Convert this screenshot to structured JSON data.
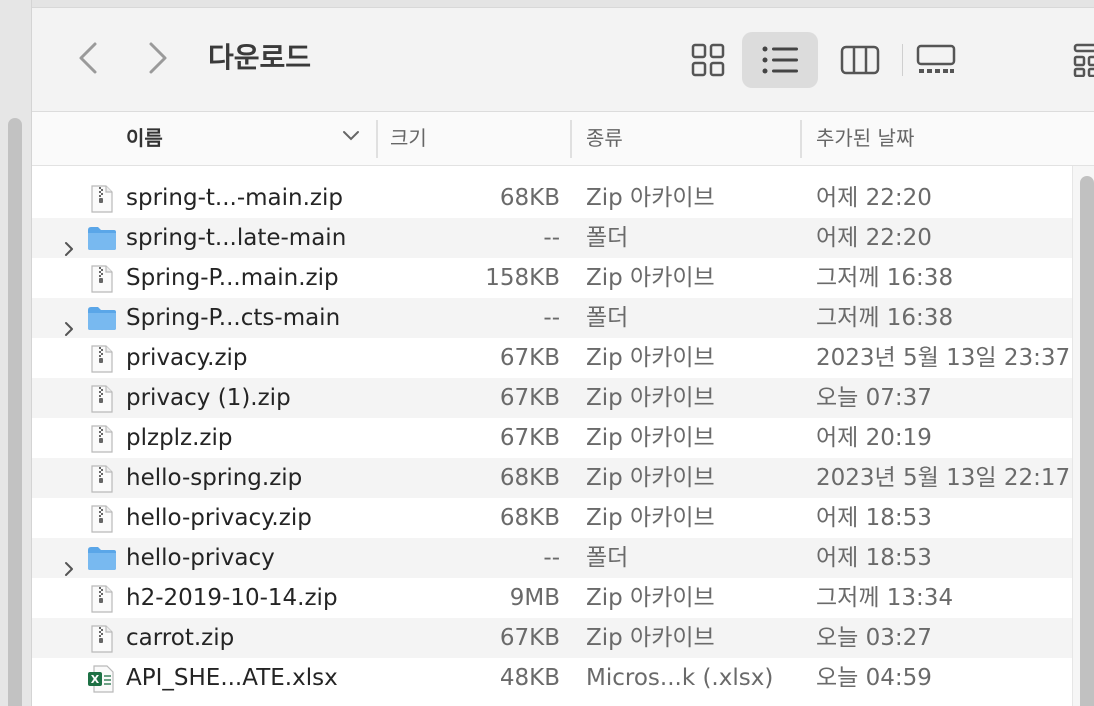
{
  "window": {
    "title": "다운로드"
  },
  "toolbar": {
    "back_icon": "chevron-left-icon",
    "forward_icon": "chevron-right-icon",
    "views": [
      {
        "name": "icon-view",
        "icon": "grid-icon",
        "active": false
      },
      {
        "name": "list-view",
        "icon": "list-icon",
        "active": true
      },
      {
        "name": "column-view",
        "icon": "columns-icon",
        "active": false
      },
      {
        "name": "gallery-view",
        "icon": "gallery-icon",
        "active": false
      },
      {
        "name": "group-view",
        "icon": "group-grid-icon",
        "active": false
      }
    ]
  },
  "columns": {
    "name": "이름",
    "size": "크기",
    "kind": "종류",
    "date_added": "추가된 날짜"
  },
  "files": [
    {
      "name": "spring-t...-main.zip",
      "size": "68KB",
      "kind": "Zip 아카이브",
      "date": "어제 22:20",
      "type": "zip"
    },
    {
      "name": "spring-t...late-main",
      "size": "--",
      "kind": "폴더",
      "date": "어제 22:20",
      "type": "folder"
    },
    {
      "name": "Spring-P...main.zip",
      "size": "158KB",
      "kind": "Zip 아카이브",
      "date": "그저께 16:38",
      "type": "zip"
    },
    {
      "name": "Spring-P...cts-main",
      "size": "--",
      "kind": "폴더",
      "date": "그저께 16:38",
      "type": "folder"
    },
    {
      "name": "privacy.zip",
      "size": "67KB",
      "kind": "Zip 아카이브",
      "date": "2023년 5월 13일 23:37",
      "type": "zip"
    },
    {
      "name": "privacy (1).zip",
      "size": "67KB",
      "kind": "Zip 아카이브",
      "date": "오늘 07:37",
      "type": "zip"
    },
    {
      "name": "plzplz.zip",
      "size": "67KB",
      "kind": "Zip 아카이브",
      "date": "어제 20:19",
      "type": "zip"
    },
    {
      "name": "hello-spring.zip",
      "size": "68KB",
      "kind": "Zip 아카이브",
      "date": "2023년 5월 13일 22:17",
      "type": "zip"
    },
    {
      "name": "hello-privacy.zip",
      "size": "68KB",
      "kind": "Zip 아카이브",
      "date": "어제 18:53",
      "type": "zip"
    },
    {
      "name": "hello-privacy",
      "size": "--",
      "kind": "폴더",
      "date": "어제 18:53",
      "type": "folder"
    },
    {
      "name": "h2-2019-10-14.zip",
      "size": "9MB",
      "kind": "Zip 아카이브",
      "date": "그저께 13:34",
      "type": "zip"
    },
    {
      "name": "carrot.zip",
      "size": "67KB",
      "kind": "Zip 아카이브",
      "date": "오늘 03:27",
      "type": "zip"
    },
    {
      "name": "API_SHE...ATE.xlsx",
      "size": "48KB",
      "kind": "Micros...k (.xlsx)",
      "date": "오늘 04:59",
      "type": "xlsx"
    }
  ],
  "colors": {
    "folder": "#5aa6e8",
    "excel": "#1e7145",
    "active_view_bg": "#dcdcdc"
  }
}
